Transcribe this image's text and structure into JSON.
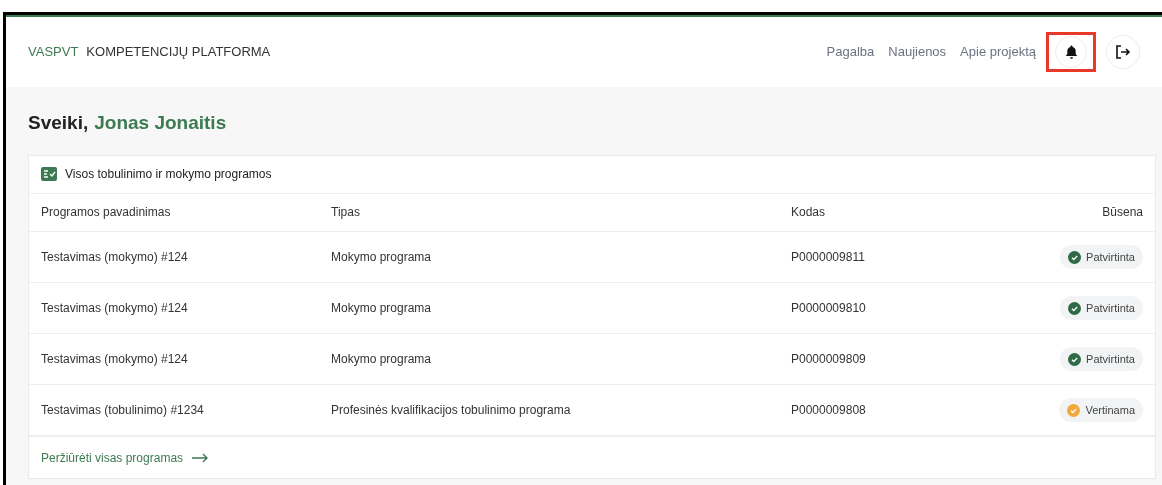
{
  "header": {
    "brand": "VASPVT",
    "title": "KOMPETENCIJŲ PLATFORMA",
    "nav": [
      "Pagalba",
      "Naujienos",
      "Apie projektą"
    ]
  },
  "greeting": {
    "prefix": "Sveiki,",
    "name": "Jonas Jonaitis"
  },
  "card": {
    "title": "Visos tobulinimo ir mokymo programos",
    "columns": [
      "Programos pavadinimas",
      "Tipas",
      "Kodas",
      "Būsena"
    ],
    "rows": [
      {
        "name": "Testavimas (mokymo) #124",
        "type": "Mokymo programa",
        "code": "P0000009811",
        "status": "Patvirtinta",
        "color": "#2f6b45"
      },
      {
        "name": "Testavimas (mokymo) #124",
        "type": "Mokymo programa",
        "code": "P0000009810",
        "status": "Patvirtinta",
        "color": "#2f6b45"
      },
      {
        "name": "Testavimas (mokymo) #124",
        "type": "Mokymo programa",
        "code": "P0000009809",
        "status": "Patvirtinta",
        "color": "#2f6b45"
      },
      {
        "name": "Testavimas (tobulinimo) #1234",
        "type": "Profesinės kvalifikacijos tobulinimo programa",
        "code": "P0000009808",
        "status": "Vertinama",
        "color": "#f0a93a"
      }
    ],
    "link": "Peržiūrėti visas programas"
  }
}
